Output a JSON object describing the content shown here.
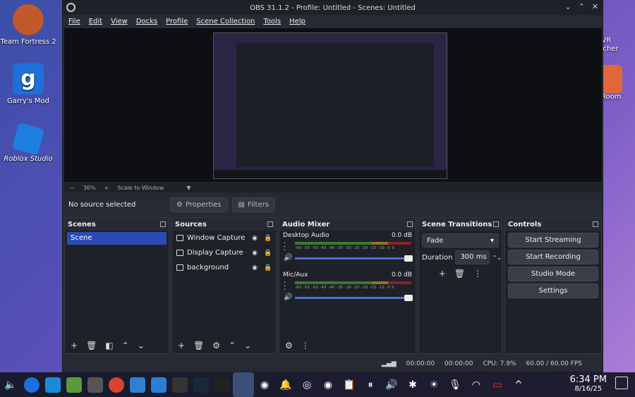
{
  "desktop": {
    "icons": [
      {
        "label": "Team Fortress 2",
        "icon": "tf2-icon",
        "color": "#c0582a"
      },
      {
        "label": "Garry's Mod",
        "icon": "gmod-icon",
        "color": "#1e6fd9"
      },
      {
        "label": "Roblox Studio",
        "icon": "roblox-studio-icon",
        "color": "#1d7ee0"
      }
    ],
    "right_partial": [
      {
        "label": "LVR\nncher"
      },
      {
        "label": "Room"
      }
    ]
  },
  "window": {
    "title": "OBS 31.1.2 - Profile: Untitled - Scenes: Untitled",
    "menu": [
      "File",
      "Edit",
      "View",
      "Docks",
      "Profile",
      "Scene Collection",
      "Tools",
      "Help"
    ]
  },
  "zoom": {
    "minus": "−",
    "value": "36%",
    "plus": "+",
    "mode": "Scale to Window"
  },
  "source_bar": {
    "status": "No source selected",
    "properties": "Properties",
    "filters": "Filters"
  },
  "docks": {
    "scenes": {
      "title": "Scenes",
      "items": [
        "Scene"
      ]
    },
    "sources": {
      "title": "Sources",
      "items": [
        "Window Capture (Xc",
        "Display Capture (XSl",
        "background"
      ]
    },
    "mixer": {
      "title": "Audio Mixer",
      "channels": [
        {
          "name": "Desktop Audio",
          "db": "0.0 dB"
        },
        {
          "name": "Mic/Aux",
          "db": "0.0 dB"
        }
      ],
      "ticks": "-60 -55 -50 -45 -40 -35 -30 -25 -20 -15 -10 -5 0"
    },
    "transitions": {
      "title": "Scene Transitions",
      "selected": "Fade",
      "duration_label": "Duration",
      "duration": "300 ms"
    },
    "controls": {
      "title": "Controls",
      "buttons": [
        "Start Streaming",
        "Start Recording",
        "Studio Mode",
        "Settings"
      ]
    }
  },
  "status": {
    "stream_time": "00:00:00",
    "rec_time": "00:00:00",
    "cpu": "CPU: 7.9%",
    "fps": "60.00 / 60.00 FPS"
  },
  "taskbar": {
    "time": "6:34 PM",
    "date": "8/16/25"
  }
}
